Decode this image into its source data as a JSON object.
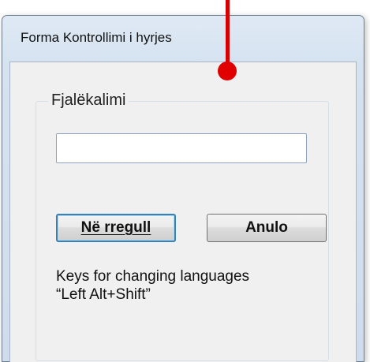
{
  "window": {
    "title": "Forma Kontrollimi i hyrjes"
  },
  "group": {
    "legend": "Fjalëkalimi"
  },
  "password_input": {
    "value": "",
    "placeholder": ""
  },
  "buttons": {
    "ok_label": "Në rregull",
    "cancel_label": "Anulo"
  },
  "hint": {
    "line1": "Keys for changing languages",
    "line2": "“Left Alt+Shift”"
  },
  "annotation": {
    "color": "#e00000"
  }
}
